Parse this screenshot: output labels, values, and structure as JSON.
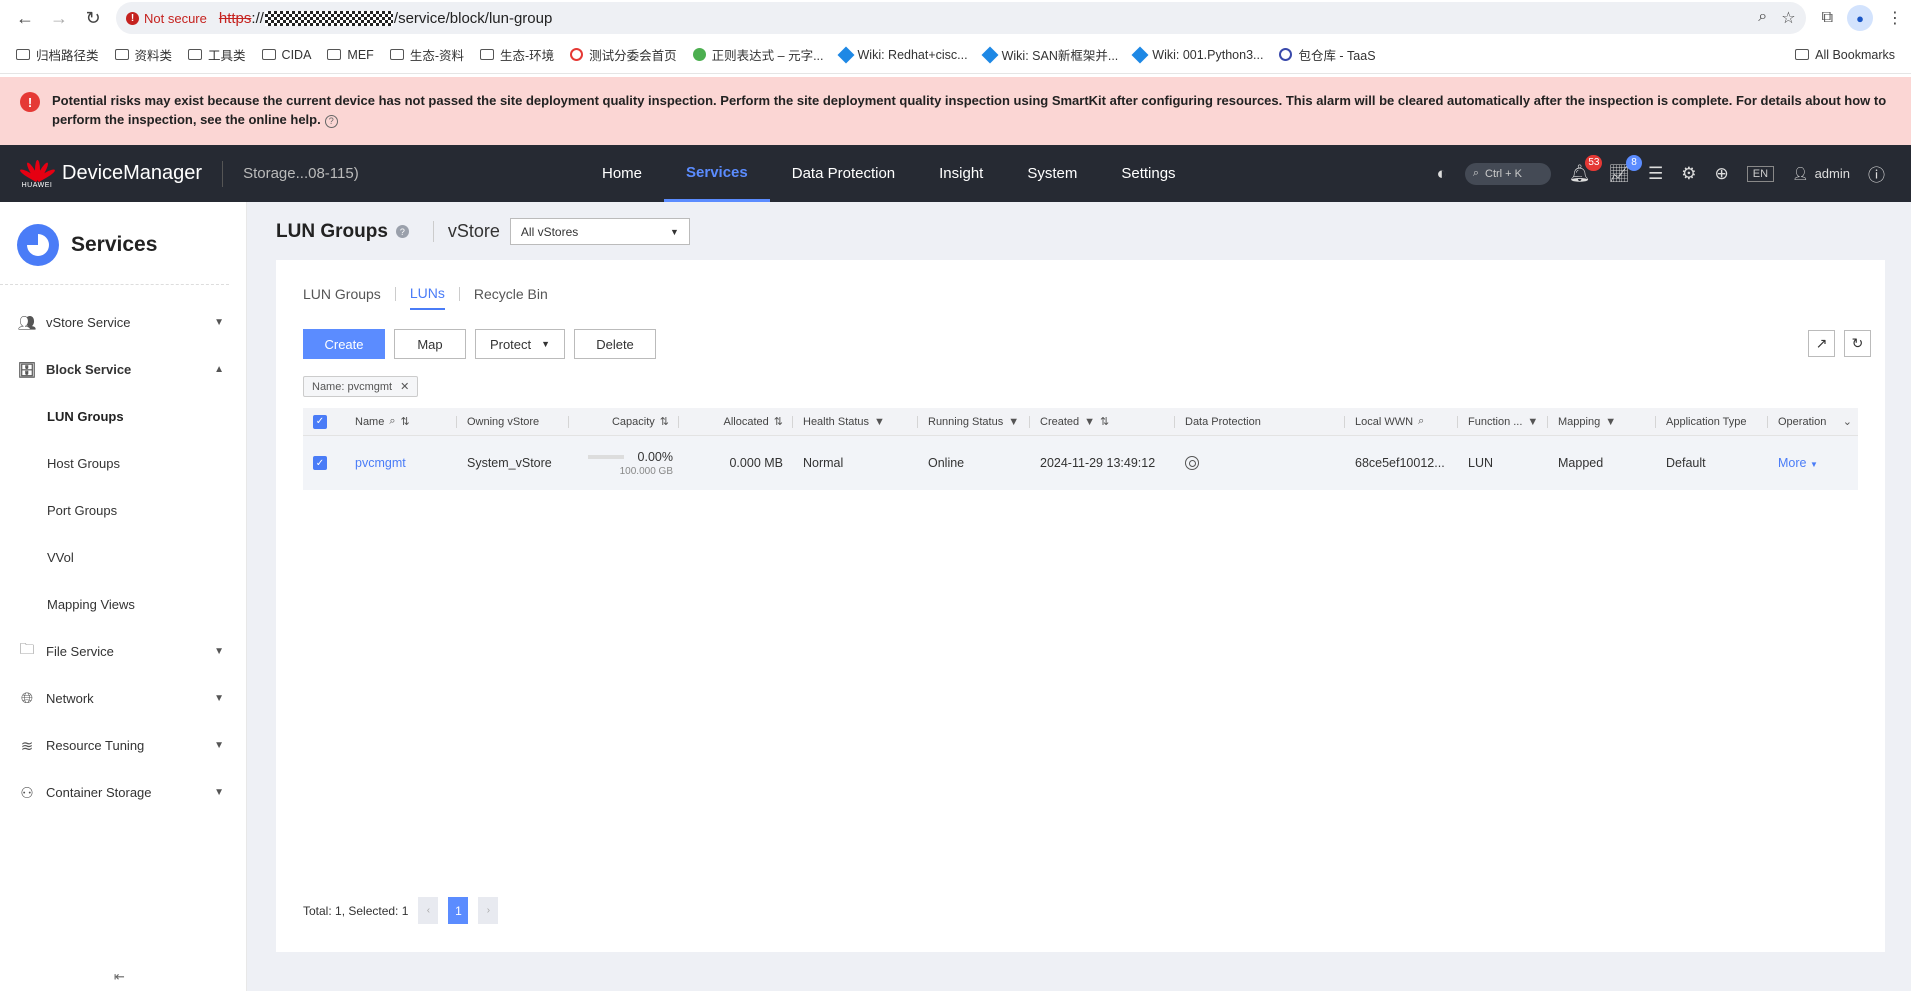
{
  "browser": {
    "not_secure": "Not secure",
    "url_scheme": "https",
    "url_sep": "://",
    "url_path": "/service/block/lun-group",
    "bookmarks": [
      "归档路径类",
      "资料类",
      "工具类",
      "CIDA",
      "MEF",
      "生态-资料",
      "生态-环境",
      "测试分委会首页",
      "正则表达式 – 元字...",
      "Wiki: Redhat+cisc...",
      "Wiki: SAN新框架并...",
      "Wiki: 001.Python3...",
      "包仓库 - TaaS"
    ],
    "all_bookmarks": "All Bookmarks"
  },
  "alarm": {
    "text": "Potential risks may exist because the current device has not passed the site deployment quality inspection. Perform the site deployment quality inspection using SmartKit after configuring resources. This alarm will be cleared automatically after the inspection is complete. For details about how to perform the inspection, see the online help."
  },
  "header": {
    "logo_text": "HUAWEI",
    "app_title": "DeviceManager",
    "device_name": "Storage...08-115)",
    "nav": [
      "Home",
      "Services",
      "Data Protection",
      "Insight",
      "System",
      "Settings"
    ],
    "active_nav": "Services",
    "search_hint": "Ctrl + K",
    "alarm_count": "53",
    "task_count": "8",
    "lang": "EN",
    "user": "admin"
  },
  "sidebar": {
    "title": "Services",
    "items": [
      {
        "label": "vStore Service"
      },
      {
        "label": "Block Service"
      },
      {
        "label": "File Service"
      },
      {
        "label": "Network"
      },
      {
        "label": "Resource Tuning"
      },
      {
        "label": "Container Storage"
      }
    ],
    "block_sub": [
      "LUN Groups",
      "Host Groups",
      "Port Groups",
      "VVol",
      "Mapping Views"
    ]
  },
  "page": {
    "title": "LUN Groups",
    "vstore_label": "vStore",
    "vstore_value": "All vStores",
    "tabs": [
      "LUN Groups",
      "LUNs",
      "Recycle Bin"
    ],
    "active_tab": "LUNs",
    "buttons": {
      "create": "Create",
      "map": "Map",
      "protect": "Protect",
      "delete": "Delete"
    },
    "filter_chip": "Name: pvcmgmt"
  },
  "table": {
    "columns": [
      "Name",
      "Owning vStore",
      "Capacity",
      "Allocated",
      "Health Status",
      "Running Status",
      "Created",
      "Data Protection",
      "Local WWN",
      "Function ...",
      "Mapping",
      "Application Type",
      "Operation"
    ],
    "row": {
      "name": "pvcmgmt",
      "owning_vstore": "System_vStore",
      "capacity_pct": "0.00%",
      "capacity_total": "100.000 GB",
      "allocated": "0.000 MB",
      "health": "Normal",
      "running": "Online",
      "created": "2024-11-29 13:49:12",
      "local_wwn": "68ce5ef10012...",
      "function": "LUN",
      "mapping": "Mapped",
      "app_type": "Default",
      "operation": "More"
    }
  },
  "pager": {
    "summary": "Total: 1, Selected: 1",
    "current": "1"
  }
}
